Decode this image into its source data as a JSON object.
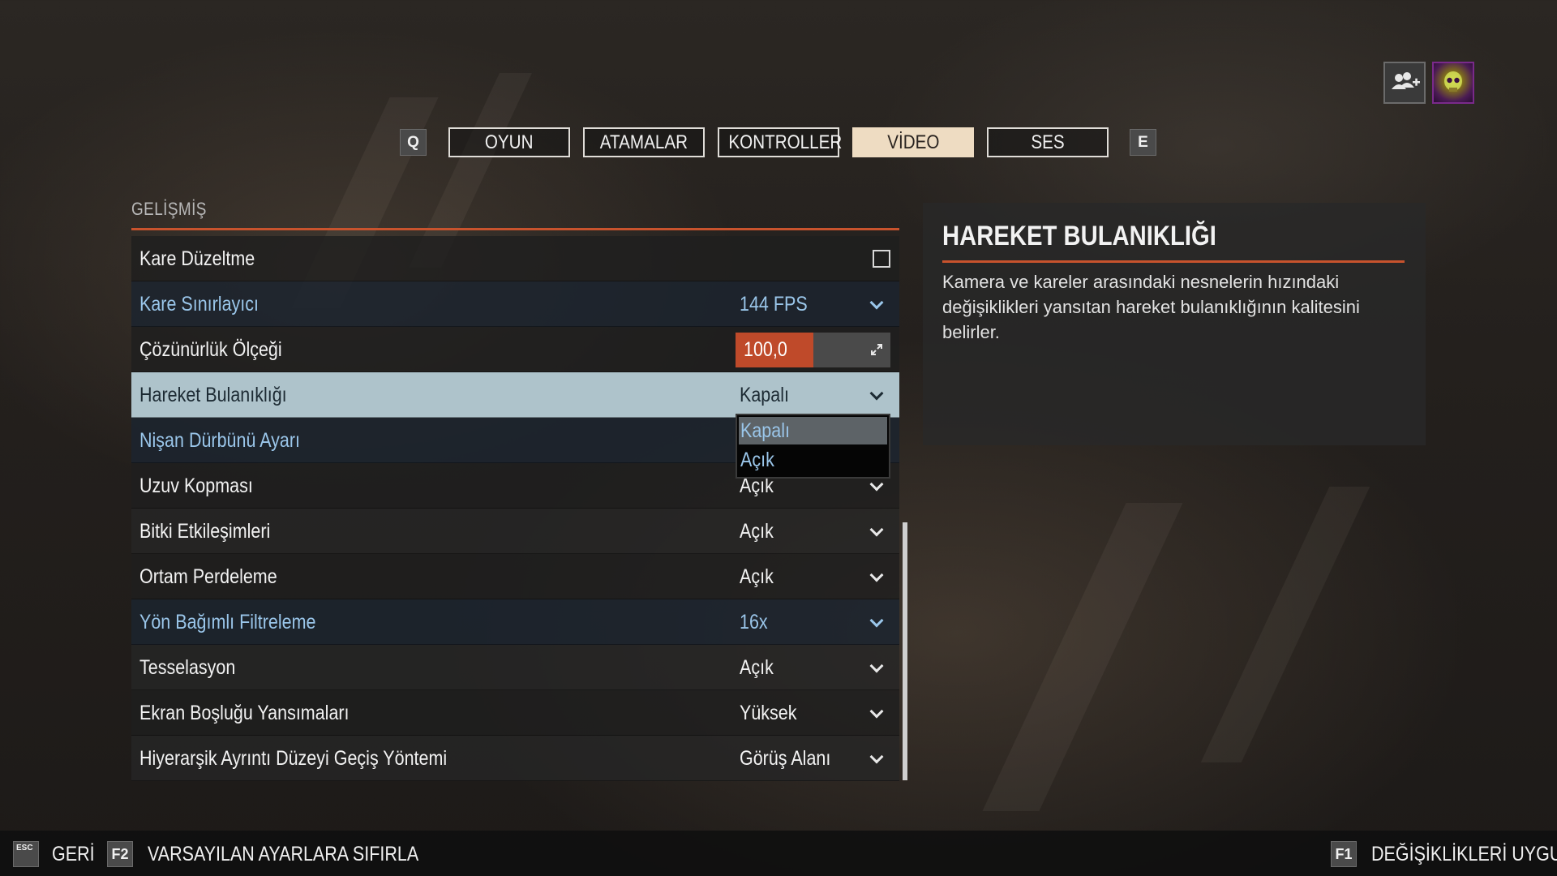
{
  "tabs": {
    "prev_key": "Q",
    "next_key": "E",
    "items": [
      {
        "label": "OYUN"
      },
      {
        "label": "ATAMALAR"
      },
      {
        "label": "KONTROLLER"
      },
      {
        "label": "VİDEO",
        "active": true
      },
      {
        "label": "SES"
      }
    ]
  },
  "top_right": {
    "social_icon": "add-friends-icon",
    "avatar_icon": "skull-avatar-icon"
  },
  "section": {
    "title": "GELİŞMİŞ"
  },
  "settings": [
    {
      "label": "Kare Düzeltme",
      "control": "checkbox",
      "checked": false
    },
    {
      "label": "Kare Sınırlayıcı",
      "value": "144 FPS",
      "control": "dropdown"
    },
    {
      "label": "Çözünürlük Ölçeği",
      "value": "100,0",
      "control": "slider",
      "fill_fraction": 0.5
    },
    {
      "label": "Hareket Bulanıklığı",
      "value": "Kapalı",
      "control": "dropdown"
    },
    {
      "label": "Nişan Dürbünü Ayarı",
      "value": "",
      "control": "dropdown"
    },
    {
      "label": "Uzuv Kopması",
      "value": "Açık",
      "control": "dropdown"
    },
    {
      "label": "Bitki Etkileşimleri",
      "value": "Açık",
      "control": "dropdown"
    },
    {
      "label": "Ortam Perdeleme",
      "value": "Açık",
      "control": "dropdown"
    },
    {
      "label": "Yön Bağımlı Filtreleme",
      "value": "16x",
      "control": "dropdown"
    },
    {
      "label": "Tesselasyon",
      "value": "Açık",
      "control": "dropdown"
    },
    {
      "label": "Ekran Boşluğu Yansımaları",
      "value": "Yüksek",
      "control": "dropdown"
    },
    {
      "label": "Hiyerarşik Ayrıntı Düzeyi Geçiş Yöntemi",
      "value": "Görüş Alanı",
      "control": "dropdown"
    }
  ],
  "dropdown_open": {
    "options": [
      "Kapalı",
      "Açık"
    ],
    "selected": "Kapalı"
  },
  "info": {
    "title": "HAREKET BULANIKLIĞI",
    "description": "Kamera ve kareler arasındaki nesnelerin hızındaki değişiklikleri yansıtan hareket bulanıklığının kalitesini belirler."
  },
  "bottom": {
    "back_key": "ESC",
    "back_label": "GERİ",
    "reset_key": "F2",
    "reset_label": "VARSAYILAN AYARLARA SIFIRLA",
    "apply_key": "F1",
    "apply_label": "DEĞİŞİKLİKLERİ UYGULA"
  },
  "colors": {
    "accent": "#c8532d",
    "highlight_row": "#aec3cb",
    "active_tab": "#eedcc2",
    "blue_text": "#9ac6ea"
  }
}
